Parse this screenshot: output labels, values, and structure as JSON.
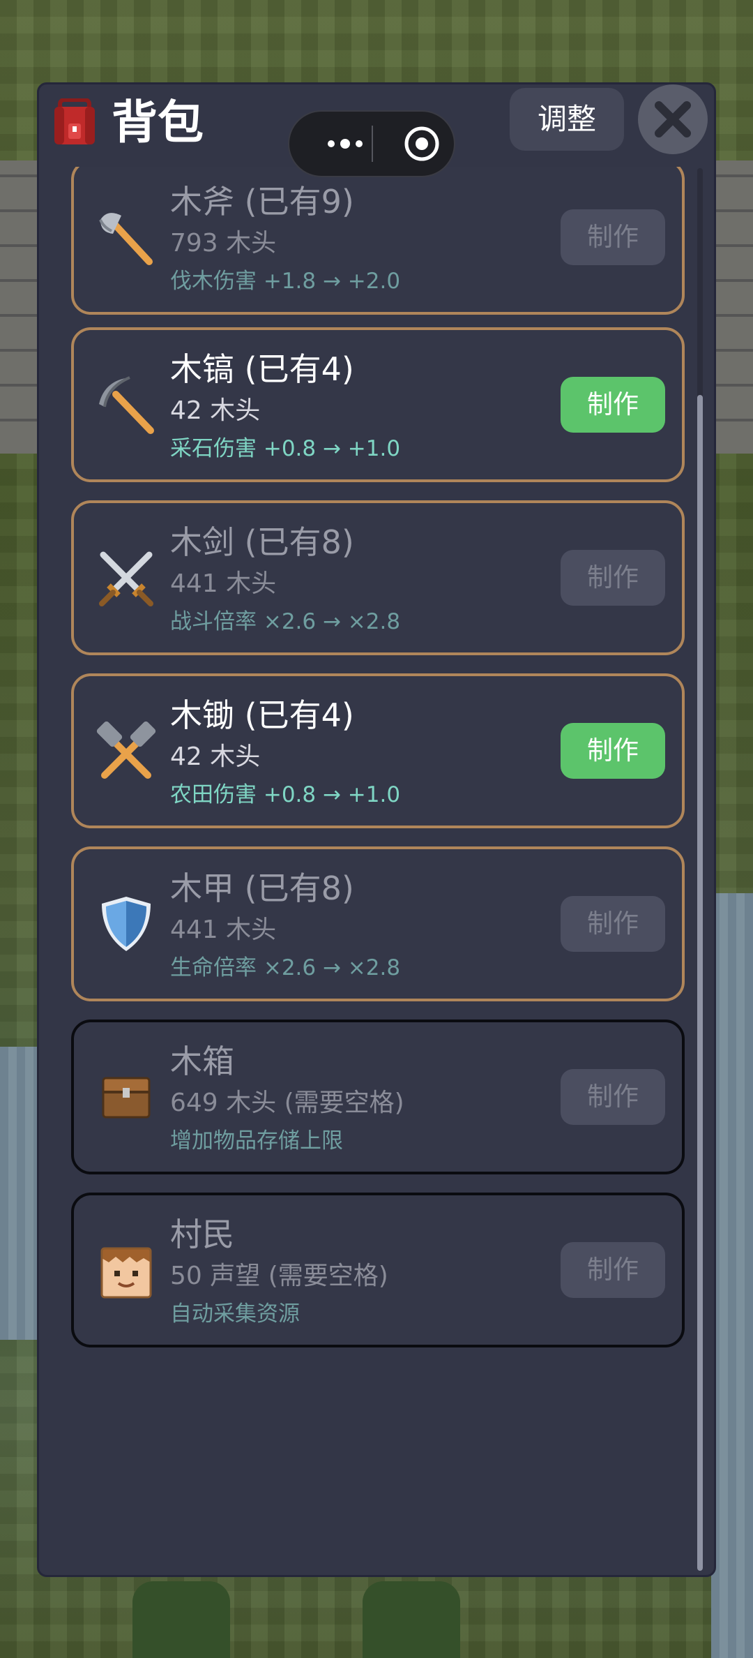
{
  "header": {
    "title": "背包",
    "adjust_label": "调整"
  },
  "items": [
    {
      "name": "木斧 (已有9)",
      "cost": "793 木头",
      "effect": "伐木伤害 +1.8 → +2.0",
      "button": "制作",
      "enabled": false,
      "icon": "axe-icon"
    },
    {
      "name": "木镐 (已有4)",
      "cost": "42 木头",
      "effect": "采石伤害 +0.8 → +1.0",
      "button": "制作",
      "enabled": true,
      "icon": "pickaxe-icon"
    },
    {
      "name": "木剑 (已有8)",
      "cost": "441 木头",
      "effect": "战斗倍率 ×2.6 → ×2.8",
      "button": "制作",
      "enabled": false,
      "icon": "crossed-swords-icon"
    },
    {
      "name": "木锄 (已有4)",
      "cost": "42 木头",
      "effect": "农田伤害 +0.8 → +1.0",
      "button": "制作",
      "enabled": true,
      "icon": "crossed-hammers-icon"
    },
    {
      "name": "木甲 (已有8)",
      "cost": "441 木头",
      "effect": "生命倍率 ×2.6 → ×2.8",
      "button": "制作",
      "enabled": false,
      "icon": "shield-icon"
    },
    {
      "name": "木箱",
      "cost": "649 木头 (需要空格)",
      "effect": "增加物品存储上限",
      "button": "制作",
      "enabled": false,
      "icon": "chest-icon"
    },
    {
      "name": "村民",
      "cost": "50 声望 (需要空格)",
      "effect": "自动采集资源",
      "button": "制作",
      "enabled": false,
      "icon": "villager-face-icon"
    }
  ],
  "colors": {
    "panel": "#333647",
    "card_border": "#b0865a",
    "craft_active": "#5cc46b",
    "effect_text": "#7fd6c4"
  }
}
